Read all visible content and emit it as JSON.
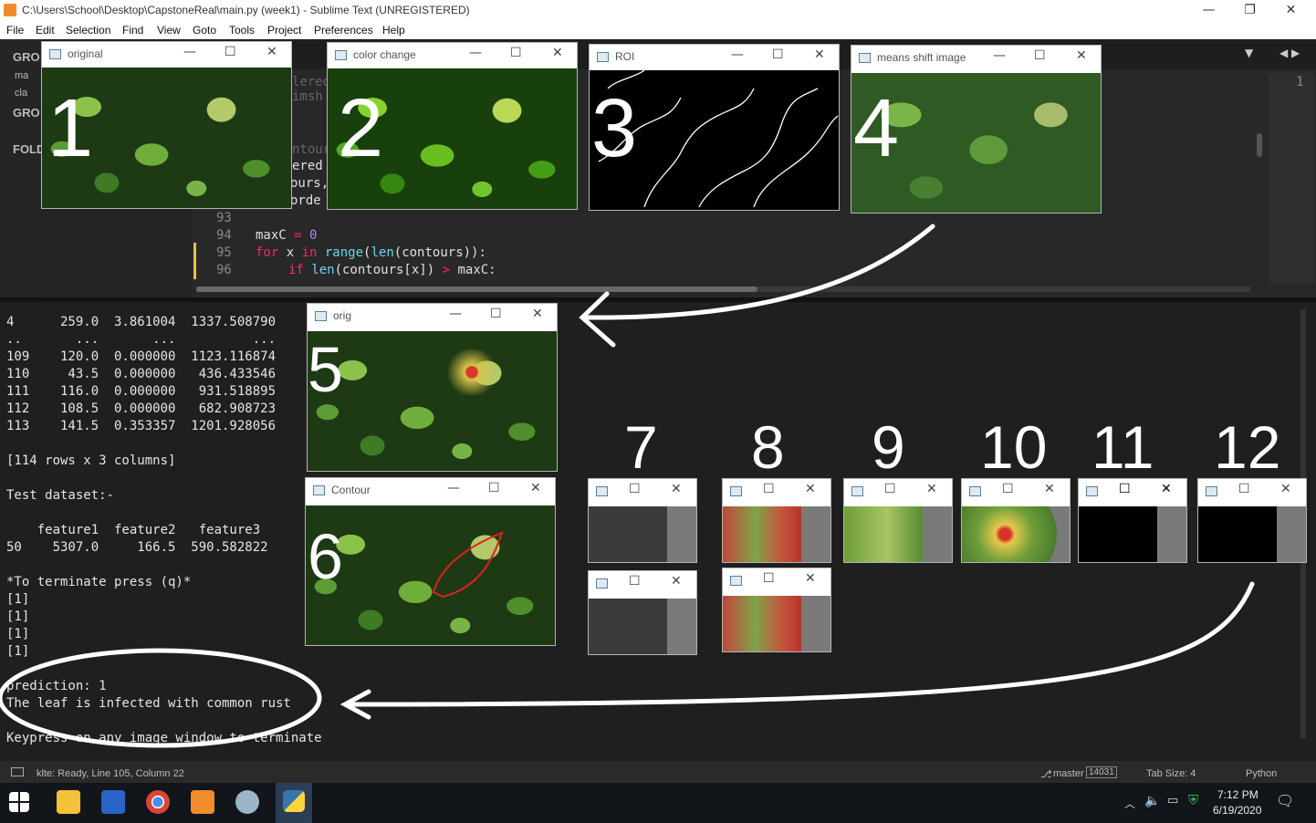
{
  "app": {
    "title": "C:\\Users\\School\\Desktop\\CapstoneReal\\main.py (week1) - Sublime Text (UNREGISTERED)",
    "window_controls": {
      "minimize": "—",
      "maximize": "❐",
      "close": "✕"
    }
  },
  "menu": [
    "File",
    "Edit",
    "Selection",
    "Find",
    "View",
    "Goto",
    "Tools",
    "Project",
    "Preferences",
    "Help"
  ],
  "sidebar": {
    "groups": [
      "GRO",
      "GRO"
    ],
    "files": [
      "ma",
      "cla"
    ],
    "folders": "FOLD"
  },
  "editor": {
    "line_numbers": [
      "93",
      "94",
      "95",
      "96"
    ],
    "code": {
      "l94": {
        "a": "maxC ",
        "op": "=",
        "num": " 0"
      },
      "l95": {
        "kw1": "for",
        "t1": " x ",
        "kw2": "in",
        "fn1": " range",
        "t2": "(",
        "fn2": "len",
        "t3": "(contours)):"
      },
      "l96": {
        "kw1": "if",
        "fn1": " len",
        "t1": "(contours[x]) ",
        "op": ">",
        "t2": " maxC:"
      }
    },
    "partial_text": [
      "lered",
      "imsh",
      "ntour",
      "ered",
      "ours,",
      "orde"
    ],
    "minimap_line": "1"
  },
  "console": {
    "lines": [
      "4      259.0  3.861004  1337.508790",
      "..       ...       ...          ...",
      "109    120.0  0.000000  1123.116874",
      "110     43.5  0.000000   436.433546",
      "111    116.0  0.000000   931.518895",
      "112    108.5  0.000000   682.908723",
      "113    141.5  0.353357  1201.928056",
      "",
      "[114 rows x 3 columns]",
      "",
      "Test dataset:-",
      "",
      "    feature1  feature2   feature3",
      "50    5307.0     166.5  590.582822",
      "",
      "*To terminate press (q)*",
      "[1]",
      "[1]",
      "[1]",
      "[1]",
      "",
      "prediction: 1",
      "The leaf is infected with common rust",
      "",
      "Keypress on any image window to terminate"
    ]
  },
  "status": {
    "left": "klte: Ready, Line 105, Column 22",
    "branch": "master",
    "branch_badge": "14031",
    "tab_size": "Tab Size: 4",
    "syntax": "Python"
  },
  "taskbar": {
    "time": "7:12 PM",
    "date": "6/19/2020"
  },
  "windows": {
    "original": "original",
    "color_change": "color change",
    "roi": "ROI",
    "means_shift": "means shift image",
    "orig": "orig",
    "contour": "Contour"
  },
  "annotations": [
    "1",
    "2",
    "3",
    "4",
    "5",
    "6",
    "7",
    "8",
    "9",
    "10",
    "11",
    "12"
  ]
}
